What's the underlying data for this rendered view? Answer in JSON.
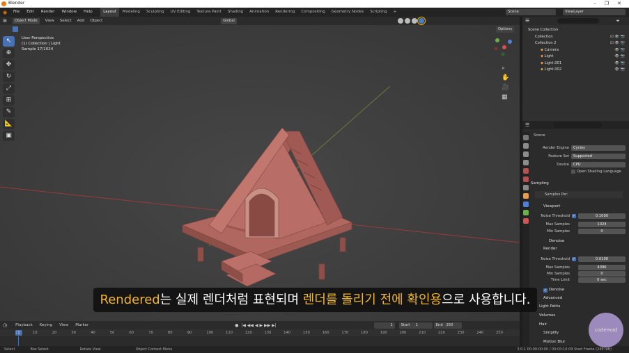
{
  "window": {
    "title": "Blender"
  },
  "menu": [
    "File",
    "Edit",
    "Render",
    "Window",
    "Help"
  ],
  "workspaces": [
    "Layout",
    "Modeling",
    "Sculpting",
    "UV Editing",
    "Texture Paint",
    "Shading",
    "Animation",
    "Rendering",
    "Compositing",
    "Geometry Nodes",
    "Scripting"
  ],
  "scene_field": "Scene",
  "viewlayer_field": "ViewLayer",
  "viewport_header": {
    "mode": "Object Mode",
    "view": "View",
    "select": "Select",
    "add": "Add",
    "object": "Object",
    "transform": "Global",
    "options": "Options"
  },
  "viewport_info": {
    "line1": "User Perspective",
    "line2": "(1) Collection | Light",
    "line3": "Sample 17/1024"
  },
  "outliner": {
    "root": "Scene Collection",
    "items": [
      {
        "label": "Collection",
        "level": 1
      },
      {
        "label": "Collection 2",
        "level": 1
      },
      {
        "label": "Camera",
        "level": 2
      },
      {
        "label": "Light",
        "level": 2
      },
      {
        "label": "Light.001",
        "level": 2
      },
      {
        "label": "Light.002",
        "level": 2
      }
    ]
  },
  "properties": {
    "context": "Scene",
    "render_engine_label": "Render Engine",
    "render_engine": "Cycles",
    "feature_set_label": "Feature Set",
    "feature_set": "Supported",
    "device_label": "Device",
    "device": "CPU",
    "osl_label": "Open Shading Language",
    "sampling": "Sampling",
    "samples_per": "Samples Per:",
    "viewport": "Viewport",
    "noise_threshold_label": "Noise Threshold",
    "vp_noise_threshold": "0.1000",
    "max_samples_label": "Max Samples",
    "vp_max_samples": "1024",
    "min_samples_label": "Min Samples",
    "vp_min_samples": "0",
    "denoise": "Denoise",
    "render": "Render",
    "r_noise_threshold": "0.0100",
    "r_max_samples": "4096",
    "r_min_samples": "0",
    "time_limit_label": "Time Limit",
    "time_limit": "0 sec",
    "advanced": "Advanced",
    "light_paths": "Light Paths",
    "volumes": "Volumes",
    "hair": "Hair",
    "simplify": "Simplify",
    "motion_blur": "Motion Blur"
  },
  "timeline": {
    "playback": "Playback",
    "keying": "Keying",
    "view": "View",
    "marker": "Marker",
    "current_frame": "1",
    "start_label": "Start",
    "start": "1",
    "end_label": "End",
    "end": "250",
    "ticks": [
      "1",
      "10",
      "20",
      "30",
      "40",
      "50",
      "60",
      "70",
      "80",
      "90",
      "100",
      "110",
      "120",
      "130",
      "140",
      "150",
      "160",
      "170",
      "180",
      "190",
      "200",
      "210",
      "220",
      "230",
      "240",
      "250"
    ]
  },
  "statusbar": {
    "select": "Select",
    "box_select": "Box Select",
    "rotate_view": "Rotate View",
    "context_menu": "Object Context Menu",
    "right": "3.0.1  00:00:00:00 / 00:00:10:09  Start Frame (249 left)"
  },
  "subtitle": {
    "hl1": "Rendered",
    "t1": "는 실제 렌더처럼 표현되며 ",
    "hl2": "렌더를 돌리기 전에 확인용",
    "t2": "으로 사용합니다."
  },
  "watermark": "codemod",
  "colors": {
    "accent": "#4772b3",
    "highlight": "#f2b62f",
    "house": "#b0675f",
    "select_frame": "#f0b400"
  }
}
